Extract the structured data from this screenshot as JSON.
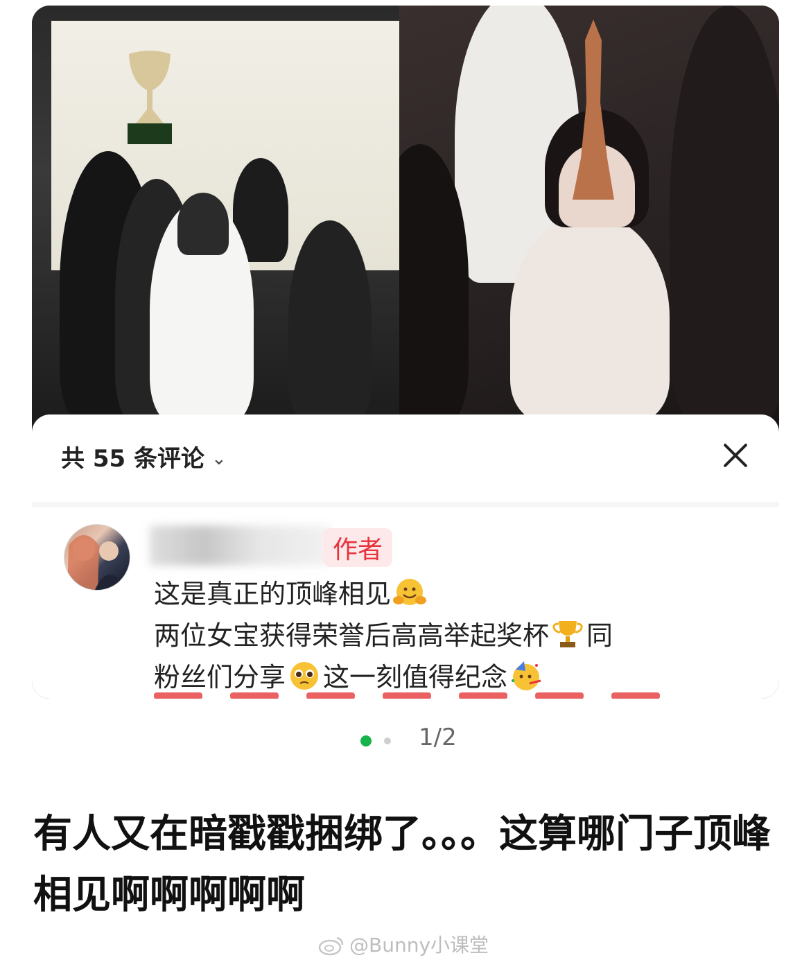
{
  "comment_sheet": {
    "title": "共 55 条评论",
    "author_tag": "作者",
    "comment_lines": [
      "这是真正的顶峰相见",
      "两位女宝获得荣誉后高高举起奖杯",
      "同",
      "粉丝们分享",
      "这一刻值得纪念"
    ]
  },
  "pager": {
    "counter": "1/2"
  },
  "post": {
    "text": "有人又在暗戳戳捆绑了。。。这算哪门子顶峰相见啊啊啊啊啊"
  },
  "watermark": {
    "text": "@Bunny小课堂"
  },
  "icons": [
    "chevron-down-icon",
    "close-icon",
    "hugging-face-emoji",
    "trophy-emoji",
    "pleading-face-emoji",
    "party-face-emoji",
    "weibo-logo-icon"
  ],
  "colors": {
    "accent_green": "#17b34a",
    "author_red": "#e8323c"
  }
}
